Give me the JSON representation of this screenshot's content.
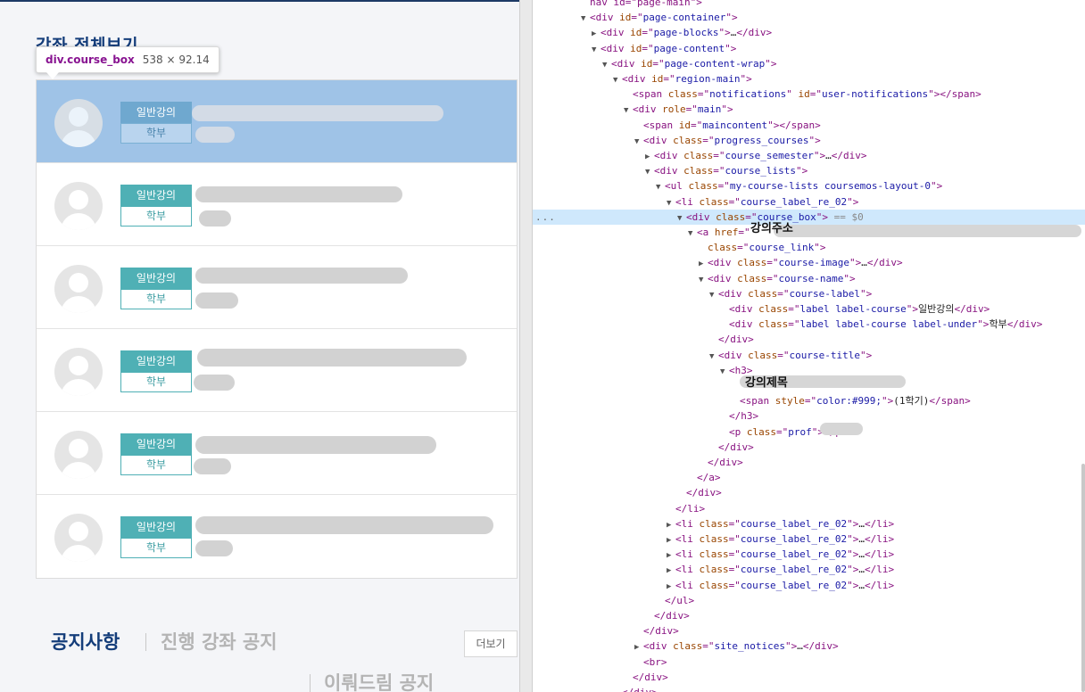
{
  "page": {
    "section_title": "강좌 전체보기",
    "tooltip": {
      "tag": "div.course_box",
      "dims": "538 × 92.14"
    },
    "courses": [
      {
        "label": "일반강의",
        "sub": "학부"
      },
      {
        "label": "일반강의",
        "sub": "학부"
      },
      {
        "label": "일반강의",
        "sub": "학부"
      },
      {
        "label": "일반강의",
        "sub": "학부"
      },
      {
        "label": "일반강의",
        "sub": "학부"
      },
      {
        "label": "일반강의",
        "sub": "학부"
      }
    ],
    "notices": {
      "title": "공지사항",
      "tab_active": "진행 강좌 공지",
      "more_label": "더보기",
      "tab2": "이뤄드림 공지"
    }
  },
  "devtools": {
    "dots": "...",
    "sel_eq": "== $0",
    "annotations": {
      "link_url": "강의주소",
      "course_title": "강의제목"
    },
    "lines": [
      {
        "indent": 4,
        "tri": "",
        "parts": [
          [
            "t",
            "nav id=\"page-main\">"
          ]
        ]
      },
      {
        "indent": 4,
        "tri": "▼",
        "parts": [
          [
            "t",
            "<div "
          ],
          [
            "a",
            "id"
          ],
          [
            "t",
            "=\""
          ],
          [
            "v",
            "page-container"
          ],
          [
            "t",
            "\">"
          ]
        ]
      },
      {
        "indent": 5,
        "tri": "▶",
        "parts": [
          [
            "t",
            "<div "
          ],
          [
            "a",
            "id"
          ],
          [
            "t",
            "=\""
          ],
          [
            "v",
            "page-blocks"
          ],
          [
            "t",
            "\">"
          ],
          [
            "x",
            "…"
          ],
          [
            "t",
            "</div>"
          ]
        ]
      },
      {
        "indent": 5,
        "tri": "▼",
        "parts": [
          [
            "t",
            "<div "
          ],
          [
            "a",
            "id"
          ],
          [
            "t",
            "=\""
          ],
          [
            "v",
            "page-content"
          ],
          [
            "t",
            "\">"
          ]
        ]
      },
      {
        "indent": 6,
        "tri": "▼",
        "parts": [
          [
            "t",
            "<div "
          ],
          [
            "a",
            "id"
          ],
          [
            "t",
            "=\""
          ],
          [
            "v",
            "page-content-wrap"
          ],
          [
            "t",
            "\">"
          ]
        ]
      },
      {
        "indent": 7,
        "tri": "▼",
        "parts": [
          [
            "t",
            "<div "
          ],
          [
            "a",
            "id"
          ],
          [
            "t",
            "=\""
          ],
          [
            "v",
            "region-main"
          ],
          [
            "t",
            "\">"
          ]
        ]
      },
      {
        "indent": 8,
        "tri": "",
        "parts": [
          [
            "t",
            "<span "
          ],
          [
            "a",
            "class"
          ],
          [
            "t",
            "=\""
          ],
          [
            "v",
            "notifications"
          ],
          [
            "t",
            "\" "
          ],
          [
            "a",
            "id"
          ],
          [
            "t",
            "=\""
          ],
          [
            "v",
            "user-notifications"
          ],
          [
            "t",
            "\"></span>"
          ]
        ]
      },
      {
        "indent": 8,
        "tri": "▼",
        "parts": [
          [
            "t",
            "<div "
          ],
          [
            "a",
            "role"
          ],
          [
            "t",
            "=\""
          ],
          [
            "v",
            "main"
          ],
          [
            "t",
            "\">"
          ]
        ]
      },
      {
        "indent": 9,
        "tri": "",
        "parts": [
          [
            "t",
            "<span "
          ],
          [
            "a",
            "id"
          ],
          [
            "t",
            "=\""
          ],
          [
            "v",
            "maincontent"
          ],
          [
            "t",
            "\"></span>"
          ]
        ]
      },
      {
        "indent": 9,
        "tri": "▼",
        "parts": [
          [
            "t",
            "<div "
          ],
          [
            "a",
            "class"
          ],
          [
            "t",
            "=\""
          ],
          [
            "v",
            "progress_courses"
          ],
          [
            "t",
            "\">"
          ]
        ]
      },
      {
        "indent": 10,
        "tri": "▶",
        "parts": [
          [
            "t",
            "<div "
          ],
          [
            "a",
            "class"
          ],
          [
            "t",
            "=\""
          ],
          [
            "v",
            "course_semester"
          ],
          [
            "t",
            "\">"
          ],
          [
            "x",
            "…"
          ],
          [
            "t",
            "</div>"
          ]
        ]
      },
      {
        "indent": 10,
        "tri": "▼",
        "parts": [
          [
            "t",
            "<div "
          ],
          [
            "a",
            "class"
          ],
          [
            "t",
            "=\""
          ],
          [
            "v",
            "course_lists"
          ],
          [
            "t",
            "\">"
          ]
        ]
      },
      {
        "indent": 11,
        "tri": "▼",
        "parts": [
          [
            "t",
            "<ul "
          ],
          [
            "a",
            "class"
          ],
          [
            "t",
            "=\""
          ],
          [
            "v",
            "my-course-lists coursemos-layout-0"
          ],
          [
            "t",
            "\">"
          ]
        ]
      },
      {
        "indent": 12,
        "tri": "▼",
        "parts": [
          [
            "t",
            "<li "
          ],
          [
            "a",
            "class"
          ],
          [
            "t",
            "=\""
          ],
          [
            "v",
            "course_label_re_02"
          ],
          [
            "t",
            "\">"
          ]
        ]
      },
      {
        "indent": 13,
        "tri": "▼",
        "sel": true,
        "parts": [
          [
            "t",
            "<div "
          ],
          [
            "a",
            "class"
          ],
          [
            "t",
            "=\""
          ],
          [
            "v",
            "course_box"
          ],
          [
            "t",
            "\">"
          ]
        ]
      },
      {
        "indent": 14,
        "tri": "▼",
        "parts": [
          [
            "t",
            "<a "
          ],
          [
            "a",
            "href"
          ],
          [
            "t",
            "=\""
          ]
        ]
      },
      {
        "indent": 15,
        "tri": "",
        "parts": [
          [
            "a",
            "class"
          ],
          [
            "t",
            "=\""
          ],
          [
            "v",
            "course_link"
          ],
          [
            "t",
            "\">"
          ]
        ]
      },
      {
        "indent": 15,
        "tri": "▶",
        "parts": [
          [
            "t",
            "<div "
          ],
          [
            "a",
            "class"
          ],
          [
            "t",
            "=\""
          ],
          [
            "v",
            "course-image"
          ],
          [
            "t",
            "\">"
          ],
          [
            "x",
            "…"
          ],
          [
            "t",
            "</div>"
          ]
        ]
      },
      {
        "indent": 15,
        "tri": "▼",
        "parts": [
          [
            "t",
            "<div "
          ],
          [
            "a",
            "class"
          ],
          [
            "t",
            "=\""
          ],
          [
            "v",
            "course-name"
          ],
          [
            "t",
            "\">"
          ]
        ]
      },
      {
        "indent": 16,
        "tri": "▼",
        "parts": [
          [
            "t",
            "<div "
          ],
          [
            "a",
            "class"
          ],
          [
            "t",
            "=\""
          ],
          [
            "v",
            "course-label"
          ],
          [
            "t",
            "\">"
          ]
        ]
      },
      {
        "indent": 17,
        "tri": "",
        "parts": [
          [
            "t",
            "<div "
          ],
          [
            "a",
            "class"
          ],
          [
            "t",
            "=\""
          ],
          [
            "v",
            "label label-course"
          ],
          [
            "t",
            "\">"
          ],
          [
            "x",
            "일반강의"
          ],
          [
            "t",
            "</div>"
          ]
        ]
      },
      {
        "indent": 17,
        "tri": "",
        "parts": [
          [
            "t",
            "<div "
          ],
          [
            "a",
            "class"
          ],
          [
            "t",
            "=\""
          ],
          [
            "v",
            "label label-course label-under"
          ],
          [
            "t",
            "\">"
          ],
          [
            "x",
            "학부"
          ],
          [
            "t",
            "</div>"
          ]
        ]
      },
      {
        "indent": 16,
        "tri": "",
        "parts": [
          [
            "t",
            "</div>"
          ]
        ]
      },
      {
        "indent": 16,
        "tri": "▼",
        "parts": [
          [
            "t",
            "<div "
          ],
          [
            "a",
            "class"
          ],
          [
            "t",
            "=\""
          ],
          [
            "v",
            "course-title"
          ],
          [
            "t",
            "\">"
          ]
        ]
      },
      {
        "indent": 17,
        "tri": "▼",
        "parts": [
          [
            "t",
            "<h3>"
          ]
        ]
      },
      {
        "indent": 18,
        "tri": "",
        "parts": []
      },
      {
        "indent": 18,
        "tri": "",
        "parts": [
          [
            "t",
            "<span "
          ],
          [
            "a",
            "style"
          ],
          [
            "t",
            "=\""
          ],
          [
            "v",
            "color:#999;"
          ],
          [
            "t",
            "\">"
          ],
          [
            "x",
            "(1학기)"
          ],
          [
            "t",
            "</span>"
          ]
        ]
      },
      {
        "indent": 17,
        "tri": "",
        "parts": [
          [
            "t",
            "</h3>"
          ]
        ]
      },
      {
        "indent": 17,
        "tri": "",
        "parts": [
          [
            "t",
            "<p "
          ],
          [
            "a",
            "class"
          ],
          [
            "t",
            "=\""
          ],
          [
            "v",
            "prof"
          ],
          [
            "t",
            "\">"
          ],
          [
            "t",
            "                 /p>"
          ]
        ]
      },
      {
        "indent": 16,
        "tri": "",
        "parts": [
          [
            "t",
            "</div>"
          ]
        ]
      },
      {
        "indent": 15,
        "tri": "",
        "parts": [
          [
            "t",
            "</div>"
          ]
        ]
      },
      {
        "indent": 14,
        "tri": "",
        "parts": [
          [
            "t",
            "</a>"
          ]
        ]
      },
      {
        "indent": 13,
        "tri": "",
        "parts": [
          [
            "t",
            "</div>"
          ]
        ]
      },
      {
        "indent": 12,
        "tri": "",
        "parts": [
          [
            "t",
            "</li>"
          ]
        ]
      },
      {
        "indent": 12,
        "tri": "▶",
        "parts": [
          [
            "t",
            "<li "
          ],
          [
            "a",
            "class"
          ],
          [
            "t",
            "=\""
          ],
          [
            "v",
            "course_label_re_02"
          ],
          [
            "t",
            "\">"
          ],
          [
            "x",
            "…"
          ],
          [
            "t",
            "</li>"
          ]
        ]
      },
      {
        "indent": 12,
        "tri": "▶",
        "parts": [
          [
            "t",
            "<li "
          ],
          [
            "a",
            "class"
          ],
          [
            "t",
            "=\""
          ],
          [
            "v",
            "course_label_re_02"
          ],
          [
            "t",
            "\">"
          ],
          [
            "x",
            "…"
          ],
          [
            "t",
            "</li>"
          ]
        ]
      },
      {
        "indent": 12,
        "tri": "▶",
        "parts": [
          [
            "t",
            "<li "
          ],
          [
            "a",
            "class"
          ],
          [
            "t",
            "=\""
          ],
          [
            "v",
            "course_label_re_02"
          ],
          [
            "t",
            "\">"
          ],
          [
            "x",
            "…"
          ],
          [
            "t",
            "</li>"
          ]
        ]
      },
      {
        "indent": 12,
        "tri": "▶",
        "parts": [
          [
            "t",
            "<li "
          ],
          [
            "a",
            "class"
          ],
          [
            "t",
            "=\""
          ],
          [
            "v",
            "course_label_re_02"
          ],
          [
            "t",
            "\">"
          ],
          [
            "x",
            "…"
          ],
          [
            "t",
            "</li>"
          ]
        ]
      },
      {
        "indent": 12,
        "tri": "▶",
        "parts": [
          [
            "t",
            "<li "
          ],
          [
            "a",
            "class"
          ],
          [
            "t",
            "=\""
          ],
          [
            "v",
            "course_label_re_02"
          ],
          [
            "t",
            "\">"
          ],
          [
            "x",
            "…"
          ],
          [
            "t",
            "</li>"
          ]
        ]
      },
      {
        "indent": 11,
        "tri": "",
        "parts": [
          [
            "t",
            "</ul>"
          ]
        ]
      },
      {
        "indent": 10,
        "tri": "",
        "parts": [
          [
            "t",
            "</div>"
          ]
        ]
      },
      {
        "indent": 9,
        "tri": "",
        "parts": [
          [
            "t",
            "</div>"
          ]
        ]
      },
      {
        "indent": 9,
        "tri": "▶",
        "parts": [
          [
            "t",
            "<div "
          ],
          [
            "a",
            "class"
          ],
          [
            "t",
            "=\""
          ],
          [
            "v",
            "site_notices"
          ],
          [
            "t",
            "\">"
          ],
          [
            "x",
            "…"
          ],
          [
            "t",
            "</div>"
          ]
        ]
      },
      {
        "indent": 9,
        "tri": "",
        "parts": [
          [
            "t",
            "<br>"
          ]
        ]
      },
      {
        "indent": 8,
        "tri": "",
        "parts": [
          [
            "t",
            "</div>"
          ]
        ]
      },
      {
        "indent": 7,
        "tri": "",
        "parts": [
          [
            "t",
            "</div>"
          ]
        ]
      }
    ]
  }
}
